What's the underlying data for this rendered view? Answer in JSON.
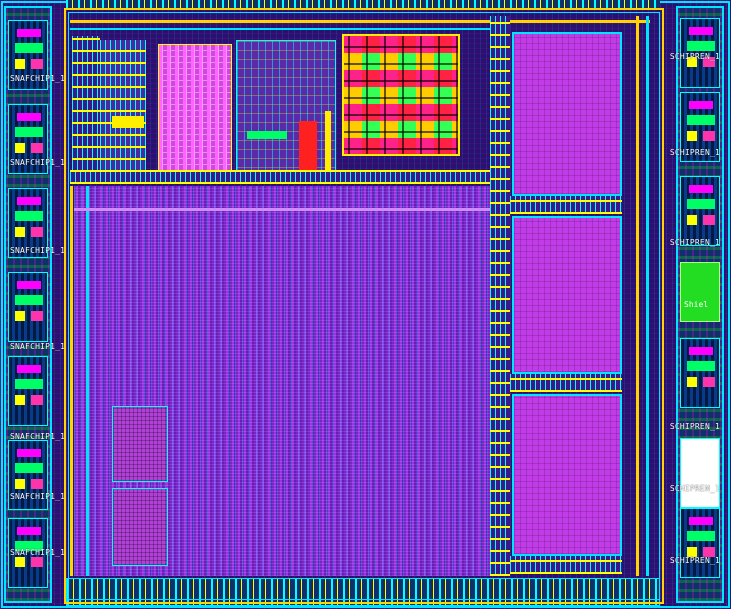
{
  "die": {
    "left_pads": [
      {
        "label": "SNAFCHIP1_1"
      },
      {
        "label": "SNAFCHIP1_1"
      },
      {
        "label": "SNAFCHIP1_1"
      },
      {
        "label": "SNAFCHIP1_1"
      },
      {
        "label": "SNAFCHIP1_1"
      },
      {
        "label": "SNAFCHIP1_1"
      },
      {
        "label": "SNAFCHIP1_1"
      }
    ],
    "right_pads": [
      {
        "label": "SCHIPREN_1"
      },
      {
        "label": "SCHIPREN_1"
      },
      {
        "label": "SCHIPREN_1"
      },
      {
        "label": "SCHIPREN_1"
      },
      {
        "label": "SCHIPREN_1"
      },
      {
        "label": "SCHIPREN_1"
      }
    ],
    "green_pad_label": "Shiel",
    "colors": {
      "metal_cyan": "#00e5ff",
      "metal_yellow": "#ffd400",
      "logic_purple": "#8a26d6",
      "sram_magenta": "#c13ce8",
      "background": "#2a1170"
    }
  }
}
